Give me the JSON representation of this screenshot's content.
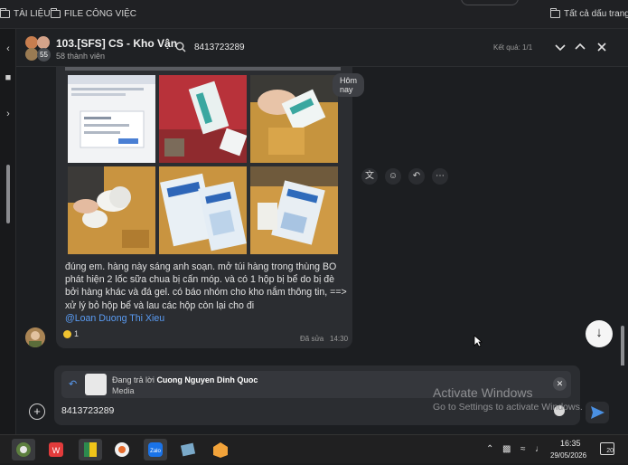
{
  "bookmarks": {
    "items": [
      "TÀI LIỆU",
      "FILE CÔNG VIỆC"
    ],
    "all_bookmarks": "Tất cả dấu trang"
  },
  "header": {
    "title": "103.[SFS] CS - Kho Vận",
    "members": "58 thành viên",
    "member_badge": "55",
    "search_value": "8413723289",
    "result": "Kết quả: 1/1"
  },
  "message": {
    "date_label": "Hôm nay",
    "text": "đúng em. hàng này sáng anh soạn. mở túi hàng trong thùng BO phát hiện 2 lốc sữa chua bị cấn móp. và có 1 hộp bị bể do bị đè bởi hàng khác và đá gel. có báo nhóm cho kho nắm thông tin, ==> xử lý bỏ hộp bể và lau các hộp còn lại cho đi",
    "mention": "@Loan Duong Thi Xieu",
    "reaction_count": "1",
    "edited": "Đã sửa",
    "time": "14:30",
    "photos": [
      "screenshot",
      "red-tray",
      "cup-hand",
      "cup-bag",
      "label-pack",
      "label-bag"
    ]
  },
  "composer": {
    "reply_prefix": "Đang trả lời",
    "reply_to": "Cuong Nguyen Dinh Quoc",
    "reply_type": "Media",
    "input_value": "8413723289"
  },
  "watermark": {
    "title": "Activate Windows",
    "subtitle": "Go to Settings to activate Windows."
  },
  "taskbar": {
    "time": "16:35",
    "date": "29/05/2026",
    "notification_count": "20"
  },
  "colors": {
    "accent": "#5a9cf4",
    "bubble": "#2b2d31",
    "background": "#1c1e21"
  }
}
